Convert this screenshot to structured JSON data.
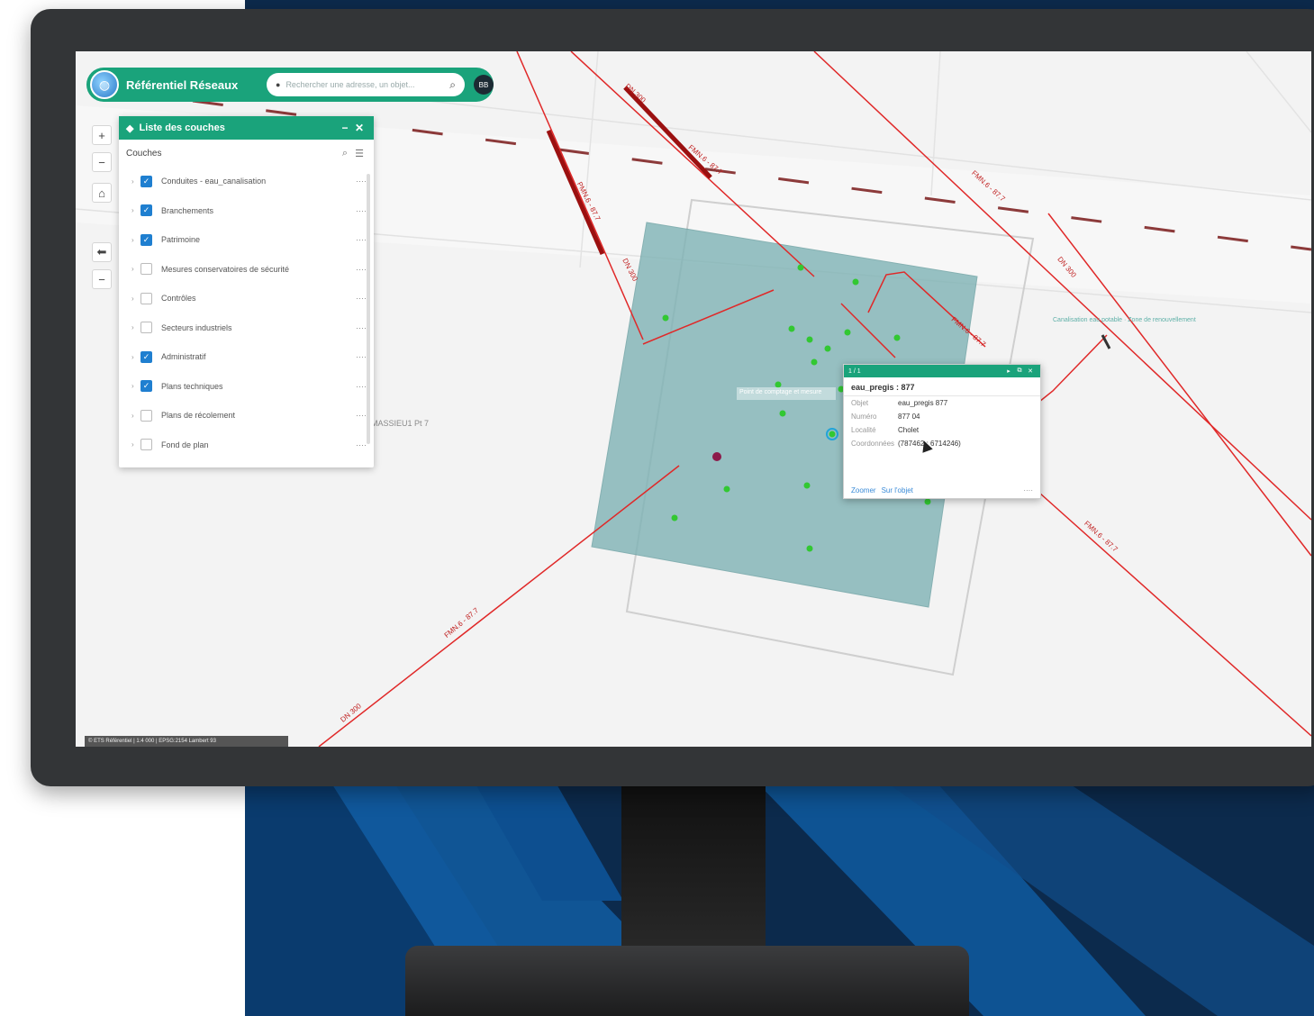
{
  "app": {
    "title": "Référentiel Réseaux",
    "search_placeholder": "Rechercher une adresse, un objet...",
    "user_initials": "BB",
    "logo_icon": "globe-icon"
  },
  "map_controls": {
    "zoom_in": "+",
    "zoom_out": "−",
    "home": "⌂",
    "back": "⬅",
    "extra": "−"
  },
  "layers_panel": {
    "title": "Liste des couches",
    "minimize": "−",
    "close": "✕",
    "section_label": "Couches",
    "search_icon": "⌕",
    "filter_icon": "☰",
    "items": [
      {
        "label": "Conduites - eau_canalisation",
        "checked": true
      },
      {
        "label": "Branchements",
        "checked": true
      },
      {
        "label": "Patrimoine",
        "checked": true
      },
      {
        "label": "Mesures conservatoires de sécurité",
        "checked": false
      },
      {
        "label": "Contrôles",
        "checked": false
      },
      {
        "label": "Secteurs industriels",
        "checked": false
      },
      {
        "label": "Administratif",
        "checked": true
      },
      {
        "label": "Plans techniques",
        "checked": true
      },
      {
        "label": "Plans de récolement",
        "checked": false
      },
      {
        "label": "Fond de plan",
        "checked": false
      }
    ],
    "more_label": "····",
    "check_mark": "✓"
  },
  "popup": {
    "header": "1 / 1",
    "header_buttons": [
      "▸",
      "⧉",
      "✕"
    ],
    "title": "eau_pregis : 877",
    "rows": [
      {
        "key": "Objet",
        "value": "eau_pregis 877"
      },
      {
        "key": "Numéro",
        "value": "877 04"
      },
      {
        "key": "Localité",
        "value": "Cholet"
      },
      {
        "key": "Coordonnées",
        "value": "(787462 ; 6714246)"
      }
    ],
    "footer_link": "Zoomer",
    "footer_link2": "Sur l'objet",
    "footer_more": "····"
  },
  "map_labels": {
    "pipe_1": "DN 300",
    "pipe_2": "FMN.6 - 87.7",
    "pipe_3": "PMN.6 - 87.7",
    "pipe_4": "DN 300",
    "pipe_5": "FMN.6 - 87.7",
    "pipe_6": "DN 300",
    "pipe_7": "FMN.6 - 87.7",
    "pipe_8": "FMN.6 - 87.7",
    "pipe_9": "DN 300",
    "parcel": "MASSIEU1 Pt 7",
    "annotation": "Canalisation eau potable · Zone de renouvellement",
    "point_label": "Point de comptage et mesure"
  },
  "status_bar": "© ETS Référentiel | 1:4 000 | EPSG:2154 Lambert 93",
  "colors": {
    "accent": "#1aa37b",
    "pipe": "#e02828",
    "pipe_major": "#9b1010",
    "zone": "#7fb3b5",
    "points": "#32c832",
    "checkbox": "#1f7fd0",
    "backdrop": "#0c2a4c"
  }
}
